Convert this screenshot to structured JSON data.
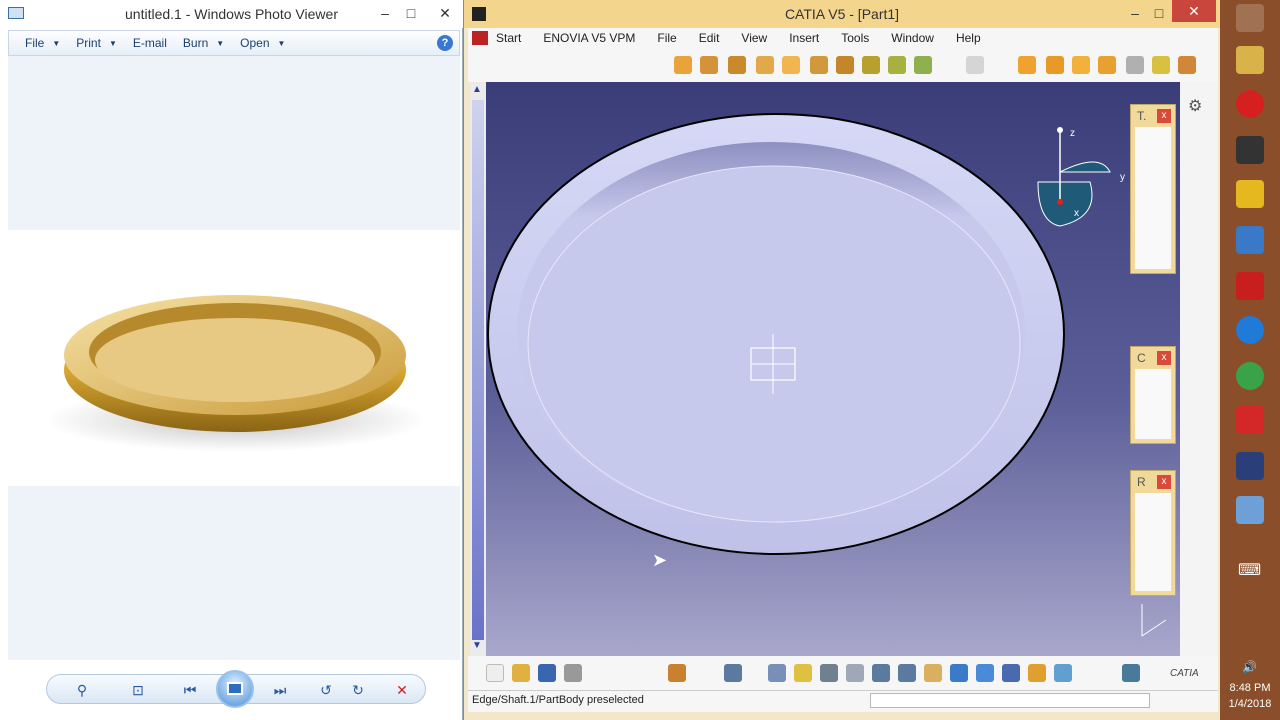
{
  "photo_viewer": {
    "title": "untitled.1 - Windows Photo Viewer",
    "menu": [
      {
        "label": "File",
        "has_dropdown": true
      },
      {
        "label": "Print",
        "has_dropdown": true
      },
      {
        "label": "E-mail",
        "has_dropdown": false
      },
      {
        "label": "Burn",
        "has_dropdown": true
      },
      {
        "label": "Open",
        "has_dropdown": true
      }
    ],
    "help_glyph": "?",
    "controls": [
      "zoom-icon",
      "actual-size-icon",
      "previous-icon",
      "slideshow-icon",
      "next-icon",
      "rotate-ccw-icon",
      "rotate-cw-icon",
      "delete-icon"
    ]
  },
  "catia": {
    "title": "CATIA V5 - [Part1]",
    "menu": [
      "Start",
      "ENOVIA V5 VPM",
      "File",
      "Edit",
      "View",
      "Insert",
      "Tools",
      "Window",
      "Help"
    ],
    "panels": [
      {
        "title": "T."
      },
      {
        "title": "C"
      },
      {
        "title": "R"
      }
    ],
    "compass_labels": {
      "z": "z",
      "y": "y",
      "x": "x"
    },
    "status_text": "Edge/Shaft.1/PartBody preselected",
    "logo_text": "CATIA",
    "close_glyph": "✕"
  },
  "taskbar": {
    "time": "8:48 PM",
    "date": "1/4/2018",
    "apps": [
      "windows-start-icon",
      "file-explorer-icon",
      "opera-icon",
      "app-icon",
      "autocad-icon",
      "app-icon",
      "solidworks-2016-icon",
      "app-icon",
      "chrome-icon",
      "sketchup-icon",
      "catia-icon",
      "photo-viewer-icon"
    ]
  },
  "colors": {
    "catia_title": "#f3d58d",
    "catia_viewport_top": "#3a3d78",
    "part_color": "#c6c8ec",
    "dish_gold": "#d9a732"
  }
}
